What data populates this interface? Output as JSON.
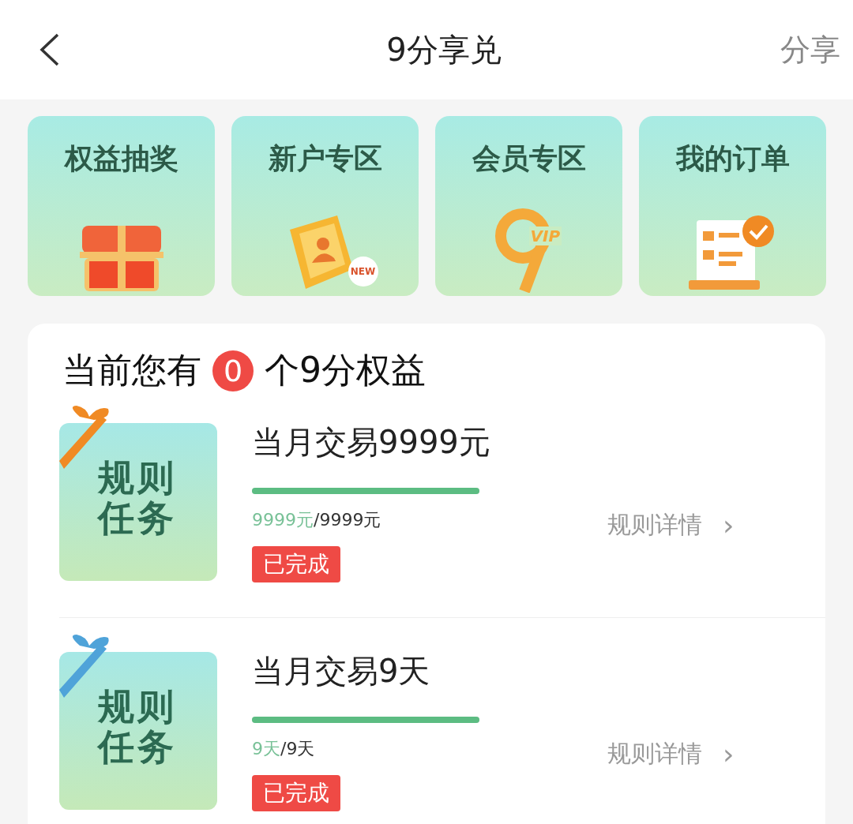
{
  "header": {
    "title": "9分享兑",
    "action": "分享"
  },
  "tiles": [
    {
      "kind": "chest",
      "label": "权益抽奖"
    },
    {
      "kind": "card",
      "label": "新户专区",
      "badge": "NEW"
    },
    {
      "kind": "vip",
      "label": "会员专区",
      "badge": "VIP"
    },
    {
      "kind": "order",
      "label": "我的订单"
    }
  ],
  "summary": {
    "prefix": "当前您有",
    "count": "0",
    "suffix": "个9分权益"
  },
  "tasks": [
    {
      "thumb_label": "规则任务",
      "color": "#f08a24",
      "title": "当月交易9999元",
      "level": 1,
      "progress_done": "9999元",
      "progress_total": "/9999元",
      "status": "已完成",
      "completed": true,
      "link": "规则详情",
      "link_icon": "›"
    },
    {
      "thumb_label": "规则任务",
      "color": "#4fa3d9",
      "title": "当月交易9天",
      "level": 1,
      "progress_done": "9天",
      "progress_total": "/9天",
      "status": "已完成",
      "completed": true,
      "link": "规则详情",
      "link_icon": "›"
    }
  ]
}
